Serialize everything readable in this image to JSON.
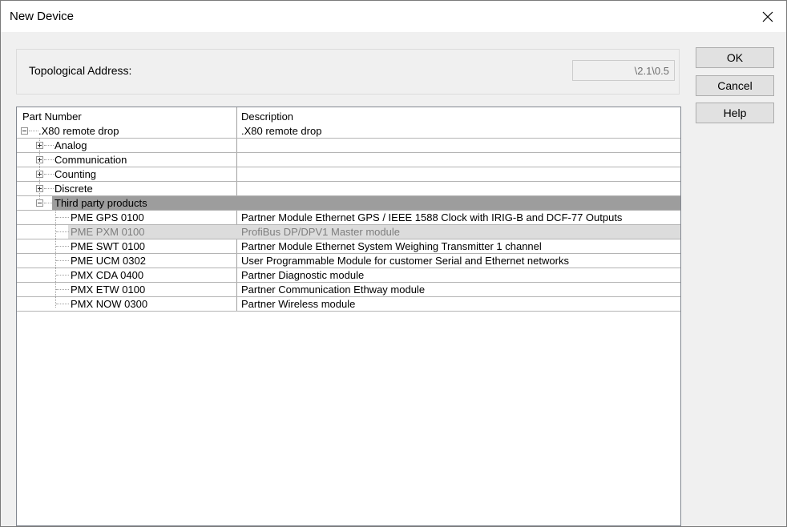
{
  "window": {
    "title": "New Device"
  },
  "address": {
    "label": "Topological Address:",
    "value": "\\2.1\\0.5"
  },
  "buttons": {
    "ok": "OK",
    "cancel": "Cancel",
    "help": "Help"
  },
  "tree": {
    "columns": {
      "part_number": "Part Number",
      "description": "Description"
    },
    "root": {
      "label": ".X80 remote drop",
      "description": ".X80 remote drop",
      "expanded": true
    },
    "categories": [
      {
        "label": "Analog",
        "expanded": false
      },
      {
        "label": "Communication",
        "expanded": false
      },
      {
        "label": "Counting",
        "expanded": false
      },
      {
        "label": "Discrete",
        "expanded": false
      },
      {
        "label": "Third party products",
        "expanded": true,
        "selected": true
      }
    ],
    "items": [
      {
        "part": "PME GPS 0100",
        "description": "Partner Module Ethernet GPS / IEEE 1588 Clock with IRIG-B and DCF-77 Outputs",
        "disabled": false
      },
      {
        "part": "PME PXM 0100",
        "description": "ProfiBus DP/DPV1 Master module",
        "disabled": true
      },
      {
        "part": "PME SWT 0100",
        "description": "Partner Module Ethernet System Weighing Transmitter 1 channel",
        "disabled": false
      },
      {
        "part": "PME UCM 0302",
        "description": "User Programmable Module for customer Serial and Ethernet networks",
        "disabled": false
      },
      {
        "part": "PMX CDA 0400",
        "description": "Partner Diagnostic module",
        "disabled": false
      },
      {
        "part": "PMX ETW 0100",
        "description": "Partner Communication Ethway module",
        "disabled": false
      },
      {
        "part": "PMX NOW 0300",
        "description": "Partner Wireless module",
        "disabled": false
      }
    ]
  }
}
